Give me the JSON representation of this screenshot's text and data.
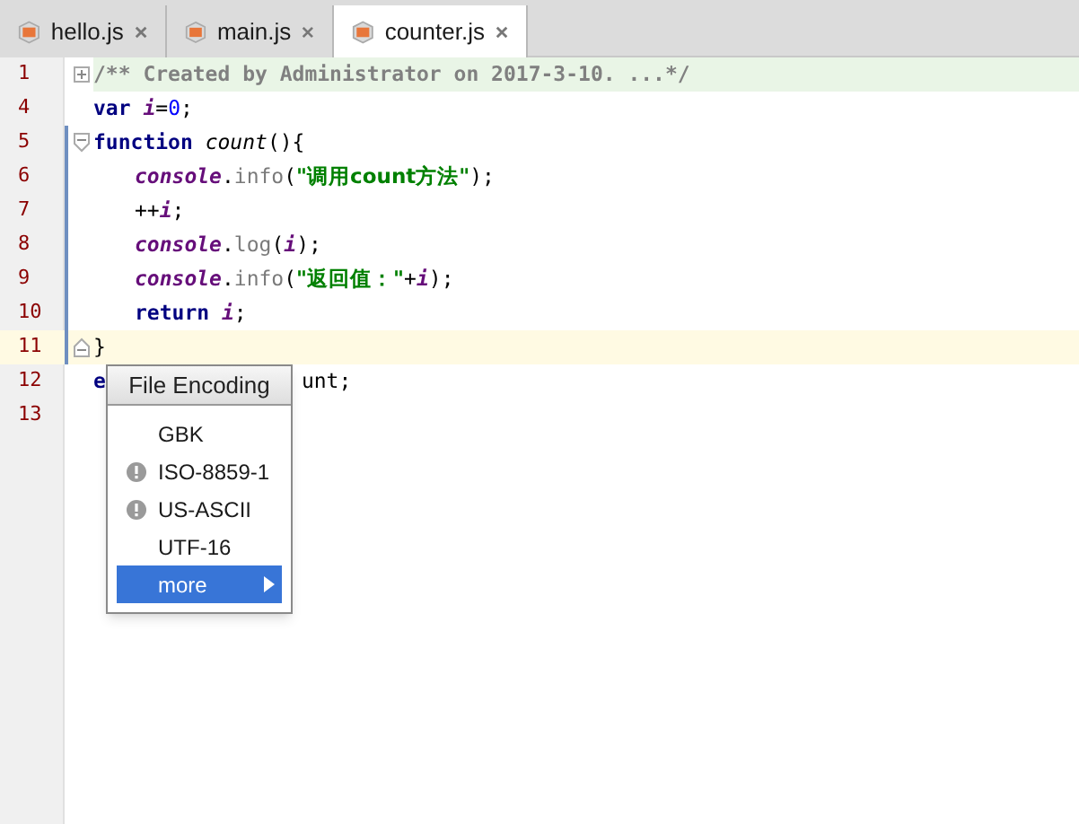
{
  "tabs": [
    {
      "label": "hello.js",
      "selected": false
    },
    {
      "label": "main.js",
      "selected": false
    },
    {
      "label": "counter.js",
      "selected": true
    }
  ],
  "editor": {
    "lines": [
      {
        "number": "1",
        "fold_marker": {
          "kind": "expand"
        },
        "current": false,
        "indented": false,
        "tokens": [
          {
            "text": "/** Created by Administrator on 2017-3-10. ...*/",
            "kind": "comment"
          }
        ]
      },
      {
        "number": "4",
        "current": false,
        "indented": false,
        "tokens": [
          {
            "text": "var ",
            "kind": "keyword"
          },
          {
            "text": "i",
            "kind": "variable"
          },
          {
            "text": "=",
            "kind": "plain"
          },
          {
            "text": "0",
            "kind": "number"
          },
          {
            "text": ";",
            "kind": "plain"
          }
        ]
      },
      {
        "number": "5",
        "fold_marker": {
          "kind": "start"
        },
        "current": false,
        "indented": false,
        "tokens": [
          {
            "text": "function ",
            "kind": "keyword"
          },
          {
            "text": "count",
            "kind": "function"
          },
          {
            "text": "(){",
            "kind": "plain"
          }
        ]
      },
      {
        "number": "6",
        "current": false,
        "indented": true,
        "tokens": [
          {
            "text": "console",
            "kind": "variable"
          },
          {
            "text": ".",
            "kind": "plain"
          },
          {
            "text": "info",
            "kind": "method"
          },
          {
            "text": "(",
            "kind": "plain"
          },
          {
            "text": "\"调用count方法\"",
            "kind": "string"
          },
          {
            "text": ");",
            "kind": "plain"
          }
        ]
      },
      {
        "number": "7",
        "current": false,
        "indented": true,
        "tokens": [
          {
            "text": "++",
            "kind": "plain"
          },
          {
            "text": "i",
            "kind": "variable"
          },
          {
            "text": ";",
            "kind": "plain"
          }
        ]
      },
      {
        "number": "8",
        "current": false,
        "indented": true,
        "tokens": [
          {
            "text": "console",
            "kind": "variable"
          },
          {
            "text": ".",
            "kind": "plain"
          },
          {
            "text": "log",
            "kind": "method"
          },
          {
            "text": "(",
            "kind": "plain"
          },
          {
            "text": "i",
            "kind": "variable"
          },
          {
            "text": ");",
            "kind": "plain"
          }
        ]
      },
      {
        "number": "9",
        "current": false,
        "indented": true,
        "tokens": [
          {
            "text": "console",
            "kind": "variable"
          },
          {
            "text": ".",
            "kind": "plain"
          },
          {
            "text": "info",
            "kind": "method"
          },
          {
            "text": "(",
            "kind": "plain"
          },
          {
            "text": "\"返回值：\"",
            "kind": "string"
          },
          {
            "text": "+",
            "kind": "plain"
          },
          {
            "text": "i",
            "kind": "variable"
          },
          {
            "text": ");",
            "kind": "plain"
          }
        ]
      },
      {
        "number": "10",
        "current": false,
        "indented": true,
        "tokens": [
          {
            "text": "return ",
            "kind": "keyword"
          },
          {
            "text": "i",
            "kind": "variable"
          },
          {
            "text": ";",
            "kind": "plain"
          }
        ]
      },
      {
        "number": "11",
        "fold_marker": {
          "kind": "end"
        },
        "current": true,
        "indented": false,
        "tokens": [
          {
            "text": "}",
            "kind": "plain"
          }
        ]
      },
      {
        "number": "12",
        "current": false,
        "indented": false,
        "tokens": [
          {
            "text": "e",
            "kind": "keyword"
          },
          {
            "text": "unt;",
            "kind": "after_cover"
          }
        ]
      },
      {
        "number": "13",
        "current": false
      }
    ]
  },
  "encoding_popup": {
    "title": "File Encoding",
    "items": [
      {
        "label": "GBK",
        "warning": false,
        "submenu": false,
        "selected": false
      },
      {
        "label": "ISO-8859-1",
        "warning": true,
        "submenu": false,
        "selected": false
      },
      {
        "label": "US-ASCII",
        "warning": true,
        "submenu": false,
        "selected": false
      },
      {
        "label": "UTF-16",
        "warning": false,
        "submenu": false,
        "selected": false
      },
      {
        "label": "more",
        "warning": false,
        "submenu": true,
        "selected": true
      }
    ]
  }
}
